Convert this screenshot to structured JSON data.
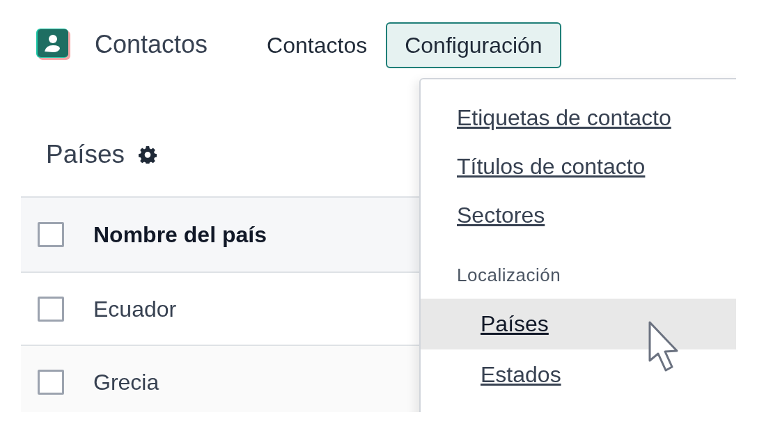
{
  "app": {
    "name": "Contactos"
  },
  "nav_menu": [
    {
      "label": "Contactos",
      "open": false
    },
    {
      "label": "Configuración",
      "open": true
    }
  ],
  "page_title": "Países",
  "table": {
    "header": {
      "label": "Nombre del país",
      "checked": false
    },
    "rows": [
      {
        "name": "Ecuador",
        "checked": false
      },
      {
        "name": "Grecia",
        "checked": false
      }
    ]
  },
  "dropdown": {
    "items": [
      {
        "kind": "item",
        "label": "Etiquetas de contacto",
        "selected": false
      },
      {
        "kind": "item",
        "label": "Títulos de contacto",
        "selected": false
      },
      {
        "kind": "item",
        "label": "Sectores",
        "selected": false
      },
      {
        "kind": "header",
        "label": "Localización"
      },
      {
        "kind": "subitem",
        "label": "Países",
        "selected": true
      },
      {
        "kind": "subitem",
        "label": "Estados",
        "selected": false
      }
    ]
  }
}
